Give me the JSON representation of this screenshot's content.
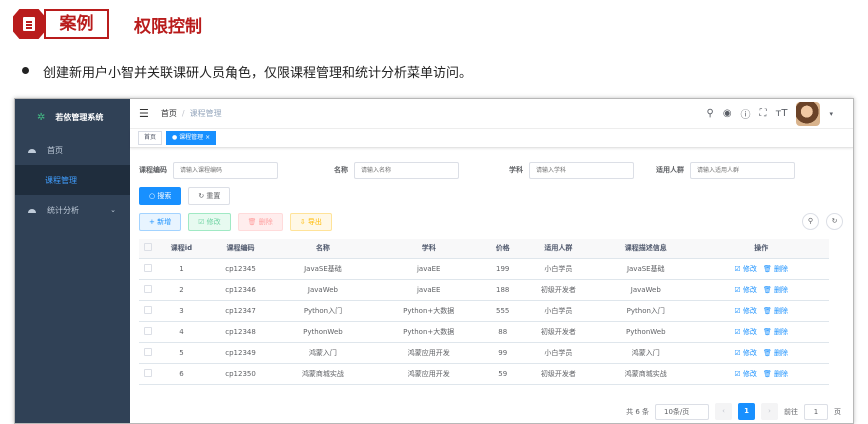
{
  "slide": {
    "tag": "案例",
    "title": "权限控制",
    "bullet": "创建新用户小智并关联课研人员角色，仅限课程管理和统计分析菜单访问。"
  },
  "app": {
    "logo_text": "若依管理系统",
    "menu": {
      "home": "首页",
      "course": "课程管理",
      "stats": "统计分析"
    },
    "breadcrumb": [
      "首页",
      "课程管理"
    ],
    "tags": [
      "首页",
      "● 课程管理 ×"
    ],
    "query": {
      "code_label": "课程编码",
      "code_placeholder": "请输入课程编码",
      "name_label": "名称",
      "name_placeholder": "请输入名称",
      "subject_label": "学科",
      "subject_placeholder": "请输入学科",
      "people_label": "适用人群",
      "people_placeholder": "请输入适用人群"
    },
    "buttons": {
      "search": "○ 搜索",
      "reset": "↻ 重置",
      "add": "+ 新增",
      "edit": "☑ 修改",
      "delete": "🗑 删除",
      "export": "⇩ 导出"
    },
    "table": {
      "headers": [
        "课程id",
        "课程编码",
        "名称",
        "学科",
        "价格",
        "适用人群",
        "课程描述信息",
        "操作"
      ],
      "rows": [
        [
          "1",
          "cp12345",
          "JavaSE基础",
          "javaEE",
          "199",
          "小白学员",
          "JavaSE基础"
        ],
        [
          "2",
          "cp12346",
          "JavaWeb",
          "javaEE",
          "188",
          "初级开发者",
          "JavaWeb"
        ],
        [
          "3",
          "cp12347",
          "Python入门",
          "Python+大数据",
          "555",
          "小白学员",
          "Python入门"
        ],
        [
          "4",
          "cp12348",
          "PythonWeb",
          "Python+大数据",
          "88",
          "初级开发者",
          "PythonWeb"
        ],
        [
          "5",
          "cp12349",
          "鸿蒙入门",
          "鸿蒙应用开发",
          "99",
          "小白学员",
          "鸿蒙入门"
        ],
        [
          "6",
          "cp12350",
          "鸿蒙商城实战",
          "鸿蒙应用开发",
          "59",
          "初级开发者",
          "鸿蒙商城实战"
        ]
      ],
      "op_edit": "☑ 修改",
      "op_delete": "🗑 删除"
    },
    "pager": {
      "total": "共 6 条",
      "size": "10条/页",
      "current": "1",
      "goto_label": "前往",
      "goto_value": "1",
      "page_unit": "页"
    }
  }
}
